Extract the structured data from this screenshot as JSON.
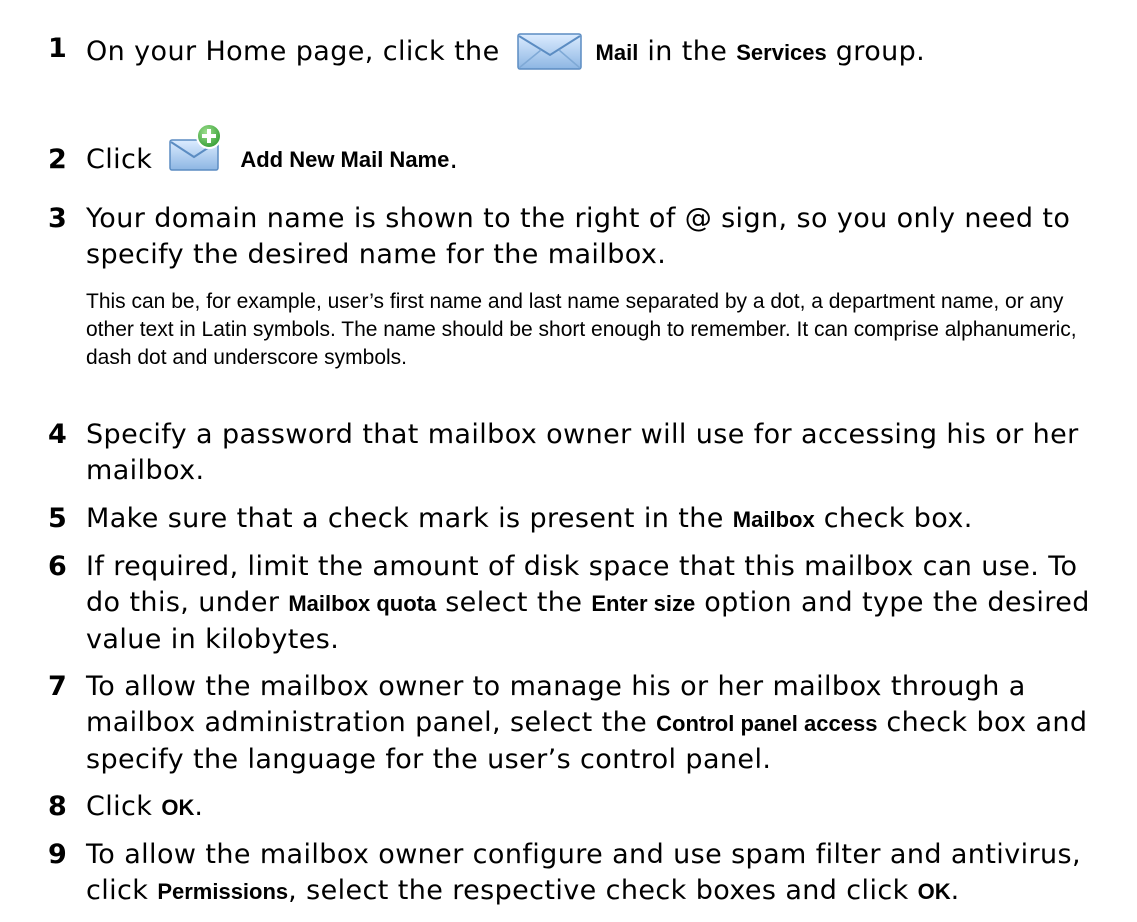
{
  "steps": [
    {
      "number": "1",
      "pre": "On your Home page, click the",
      "bold1": "Mail",
      "mid": "in the",
      "bold2": "Services",
      "post": "group.",
      "icon": "mail-envelope-icon"
    },
    {
      "number": "2",
      "pre": "Click",
      "bold1": "Add New Mail Name",
      "post": ".",
      "icon": "add-mail-icon"
    },
    {
      "number": "3",
      "text": "Your domain name is shown to the right of @ sign, so you only need to specify the desired name for the mailbox.",
      "note": "This can be, for example, user’s first name and last name separated by a dot, a department name, or any other text in Latin symbols. The name should be short enough to remember. It can comprise alphanumeric, dash dot and underscore symbols."
    },
    {
      "number": "4",
      "text": "Specify a password that mailbox owner will use for accessing his or her mailbox."
    },
    {
      "number": "5",
      "pre": "Make sure that a check mark is present in the",
      "bold1": "Mailbox",
      "post": "check box."
    },
    {
      "number": "6",
      "pre": "If required, limit the amount of disk space that this mailbox can use. To do this, under",
      "bold1": "Mailbox quota",
      "mid": "select the",
      "bold2": "Enter size",
      "post": "option and type the desired value in kilobytes."
    },
    {
      "number": "7",
      "pre": "To allow the mailbox owner to manage his or her mailbox through a mailbox administration panel, select the",
      "bold1": "Control panel access",
      "post": "check box and specify the language for the user’s control panel."
    },
    {
      "number": "8",
      "pre": "Click",
      "bold1": "OK",
      "post": "."
    },
    {
      "number": "9",
      "pre": "To allow the mailbox owner configure and use spam filter and antivirus, click",
      "bold1": "Permissions",
      "mid": ", select the respective check boxes and click",
      "bold2": "OK",
      "post": "."
    }
  ],
  "colors": {
    "text": "#000000",
    "icon_blue": "#6f9fd0",
    "icon_green": "#3aa33a"
  }
}
